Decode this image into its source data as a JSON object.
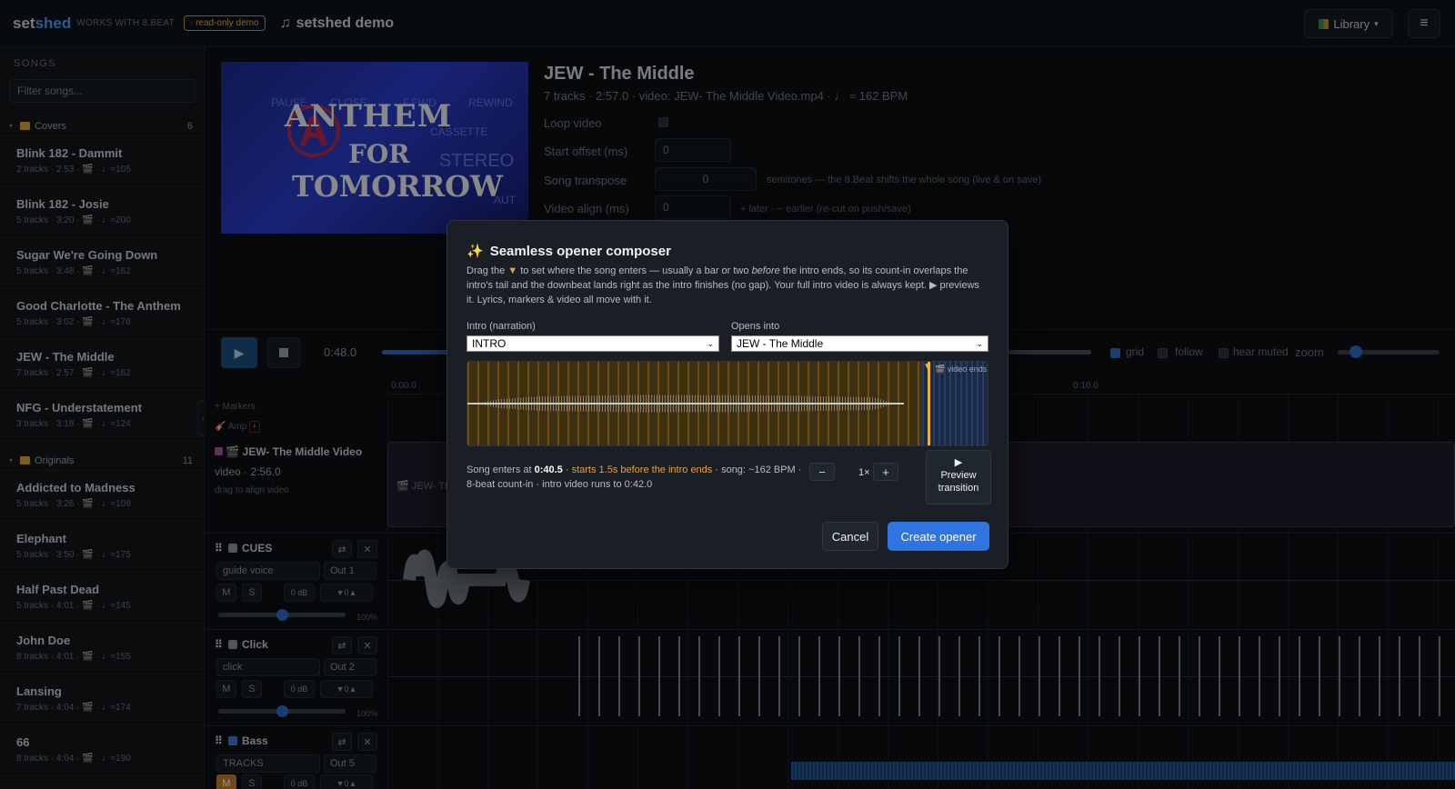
{
  "topbar": {
    "brand_a": "set",
    "brand_b": "shed",
    "works": "WORKS WITH 8.BEAT",
    "badge": "· read-only demo",
    "project": "setshed demo",
    "library": "Library",
    "library_caret": "▾",
    "menu_icon": "≡"
  },
  "sidebar": {
    "heading": "SONGS",
    "filter_placeholder": "Filter songs...",
    "folders": [
      {
        "name": "Covers",
        "count": "6"
      },
      {
        "name": "Originals",
        "count": "11"
      }
    ],
    "songs": [
      {
        "name": "Blink 182 - Dammit",
        "meta": "2 tracks · 2:53 · 🎬 · ♩≈105"
      },
      {
        "name": "Blink 182 - Josie",
        "meta": "5 tracks · 3:20 · 🎬 · ♩≈200"
      },
      {
        "name": "Sugar We're Going Down",
        "meta": "5 tracks · 3:48 · 🎬 · ♩≈162"
      },
      {
        "name": "Good Charlotte - The Anthem",
        "meta": "5 tracks · 3:02 · 🎬 · ♩≈178"
      },
      {
        "name": "JEW - The Middle",
        "meta": "7 tracks · 2:57 · 🎬 · ♩≈162"
      },
      {
        "name": "NFG - Understatement",
        "meta": "3 tracks · 3:18 · 🎬 · ♩≈124"
      },
      {
        "name": "Addicted to Madness",
        "meta": "5 tracks · 3:26 · 🎬 · ♩≈109"
      },
      {
        "name": "Elephant",
        "meta": "5 tracks · 3:50 · 🎬 · ♩≈175"
      },
      {
        "name": "Half Past Dead",
        "meta": "5 tracks · 4:01 · 🎬 · ♩≈145"
      },
      {
        "name": "John Doe",
        "meta": "8 tracks · 4:01 · 🎬 · ♩≈155"
      },
      {
        "name": "Lansing",
        "meta": "7 tracks · 4:04 · 🎬 · ♩≈174"
      },
      {
        "name": "66",
        "meta": "8 tracks · 4:04 · 🎬 · ♩≈190"
      }
    ]
  },
  "song": {
    "title": "JEW - The Middle",
    "meta": "7 tracks · 2:57.0 · video: JEW- The Middle Video.mp4 · ♩ ≈ 162 BPM",
    "loop_label": "Loop video",
    "offset_label": "Start offset (ms)",
    "offset_value": "0",
    "transpose_label": "Song transpose",
    "transpose_value": "0",
    "transpose_hint": "semitones — the 8.Beat shifts the whole song (live & on save)",
    "align_label": "Video align (ms)",
    "align_value": "0",
    "align_hint": "+ later · − earlier (re-cut on push/save)",
    "thumb_words": [
      "ANTHEM",
      "FOR",
      "TOMORROW"
    ],
    "thumb_labels": [
      "PAUSE",
      "CLOSE",
      "F.FWD",
      "REWIND",
      "CASSETTE",
      "STEREO",
      "AUT"
    ]
  },
  "transport": {
    "time": "0:48.0",
    "grid": "grid",
    "follow": "follow",
    "hear_muted": "hear muted",
    "zoom": "zoom",
    "playhead_fraction": 0.27
  },
  "timeline": {
    "ruler": [
      "0:00.0",
      "0:10.0"
    ],
    "markers": "+ Markers",
    "amp": "Amp",
    "video_track": "JEW- The Middle Video",
    "video_len": "video · 2:56.0",
    "video_hint": "drag to align video",
    "video_block_label": "JEW- Th",
    "tracks": [
      {
        "name": "CUES",
        "source": "guide voice",
        "out": "Out 1",
        "db": "0 dB",
        "semis": "0",
        "pct": "100%",
        "color": "#8b939c",
        "mute": "M",
        "solo": "S",
        "volume": 0.5
      },
      {
        "name": "Click",
        "source": "click",
        "out": "Out 2",
        "db": "0 dB",
        "semis": "0",
        "pct": "100%",
        "color": "#8b939c",
        "mute": "M",
        "solo": "S",
        "volume": 0.5
      },
      {
        "name": "Bass",
        "source": "TRACKS",
        "out": "Out 5",
        "db": "0 dB",
        "semis": "0",
        "pct": "",
        "color": "#3a7bd5",
        "mute": "M",
        "solo": "S"
      }
    ]
  },
  "modal": {
    "title": "Seamless opener composer",
    "desc_1": "Drag the ",
    "desc_tri": "▼",
    "desc_2": " to set where the song enters — usually a bar or two ",
    "desc_em": "before",
    "desc_3": " the intro ends, so its count-in overlaps the intro's tail and the downbeat lands right as the intro finishes (no gap). Your full intro video is always kept. ▶ previews it. Lyrics, markers & video all move with it.",
    "intro_label": "Intro (narration)",
    "intro_value": "INTRO",
    "opens_label": "Opens into",
    "opens_value": "JEW - The Middle",
    "video_ends": "video ends",
    "status_1": "Song enters at ",
    "status_time": "0:40.5",
    "status_sep": " · ",
    "status_hl": "starts 1.5s before the intro ends",
    "status_2": " · song: ~162 BPM · 8-beat count-in · intro video runs to 0:42.0",
    "minus": "−",
    "speed": "1×",
    "plus": "+",
    "preview_icon": "▶",
    "preview_1": "Preview",
    "preview_2": "transition",
    "cancel": "Cancel",
    "create": "Create opener",
    "entry_fraction": 0.885
  }
}
